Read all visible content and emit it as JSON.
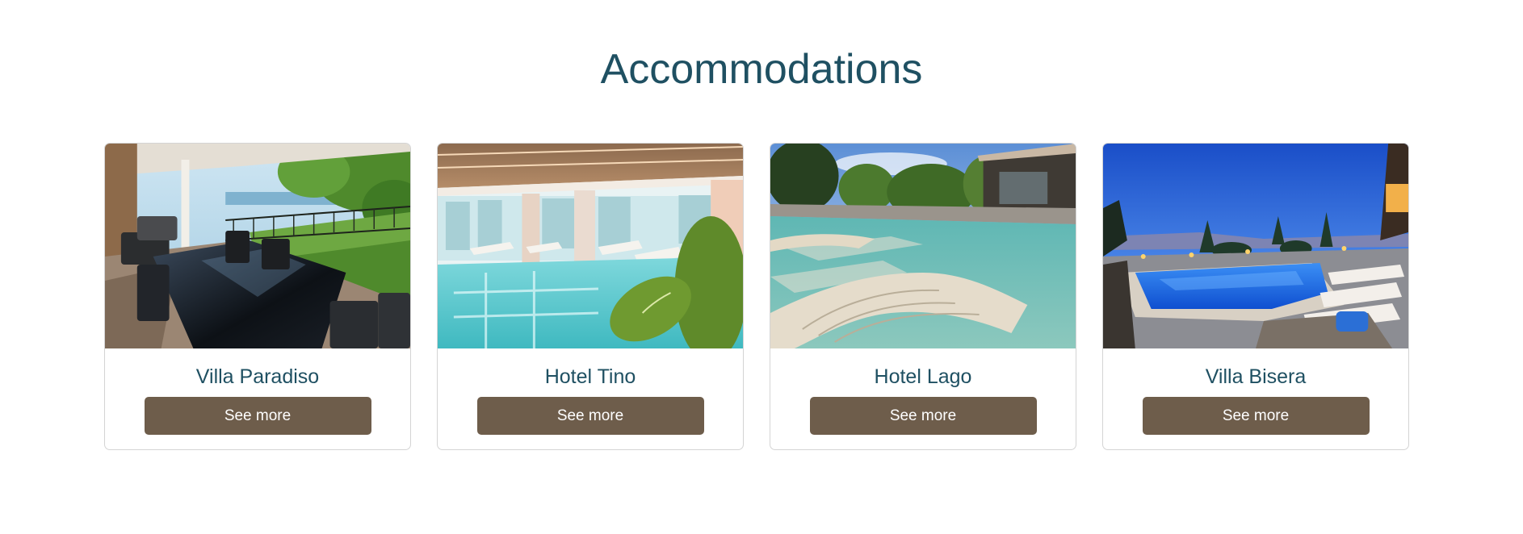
{
  "section": {
    "title": "Accommodations"
  },
  "cards": [
    {
      "title": "Villa Paradiso",
      "button_label": "See more",
      "image": "villa-terrace-photo"
    },
    {
      "title": "Hotel Tino",
      "button_label": "See more",
      "image": "indoor-pool-photo"
    },
    {
      "title": "Hotel Lago",
      "button_label": "See more",
      "image": "outdoor-pool-loungers-photo"
    },
    {
      "title": "Villa Bisera",
      "button_label": "See more",
      "image": "night-pool-lake-view-photo"
    }
  ],
  "colors": {
    "heading": "#1f5062",
    "button": "#6e5d4b",
    "button_text": "#ffffff",
    "card_border": "#d4d4d4"
  }
}
